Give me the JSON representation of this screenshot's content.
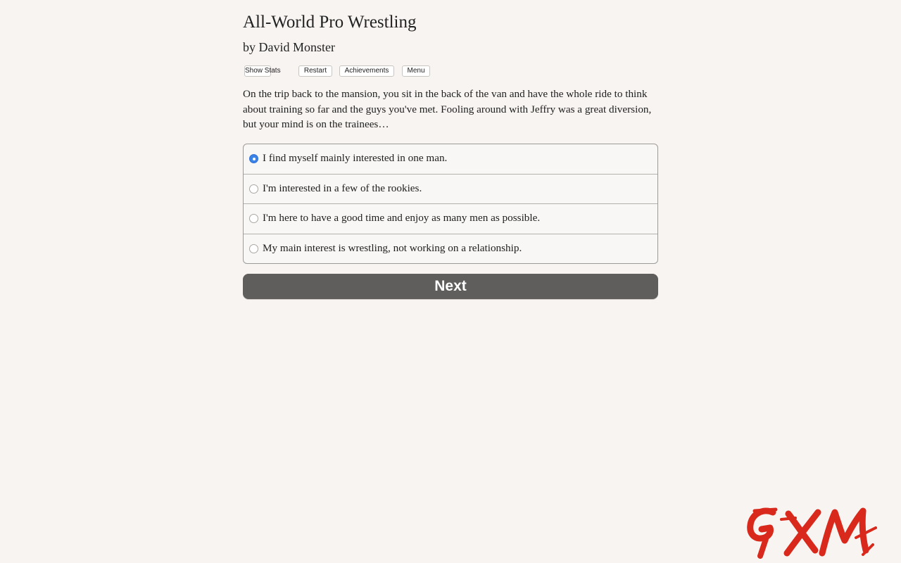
{
  "game": {
    "title": "All-World Pro Wrestling",
    "author": "by David Monster"
  },
  "toolbar": {
    "show_stats": "Show Stats",
    "restart": "Restart",
    "achievements": "Achievements",
    "menu": "Menu"
  },
  "narrative": "On the trip back to the mansion, you sit in the back of the van and have the whole ride to think about training so far and the guys you've met. Fooling around with Jeffry was a great diversion, but your mind is on the trainees…",
  "choices": [
    {
      "label": "I find myself mainly interested in one man.",
      "selected": true
    },
    {
      "label": "I'm interested in a few of the rookies.",
      "selected": false
    },
    {
      "label": "I'm here to have a good time and enjoy as many men as possible.",
      "selected": false
    },
    {
      "label": "My main interest is wrestling, not working on a relationship.",
      "selected": false
    }
  ],
  "next_label": "Next",
  "watermark": {
    "text": "GXM",
    "color": "#d9291c"
  },
  "colors": {
    "background": "#f7f4f1",
    "next_button": "#5f5e5c",
    "radio_selected": "#3b82e6"
  }
}
